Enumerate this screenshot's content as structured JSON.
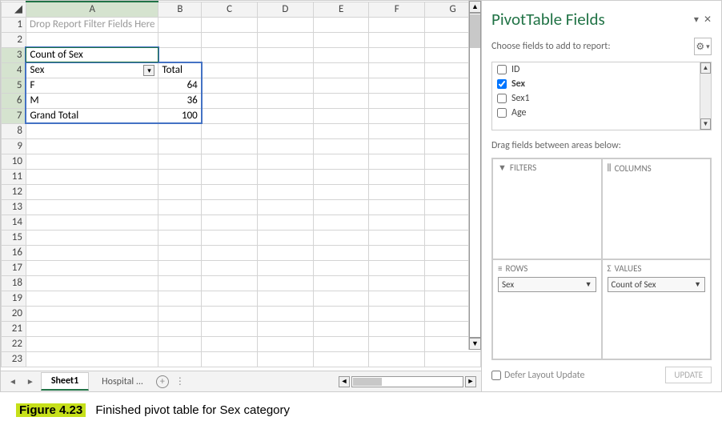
{
  "spreadsheet": {
    "columns": [
      "A",
      "B",
      "C",
      "D",
      "E",
      "F",
      "G"
    ],
    "row_count": 23,
    "drop_hint": "Drop Report Filter Fields Here",
    "pivot": {
      "title": "Count of Sex",
      "row_header": "Sex",
      "col_header": "Total",
      "rows": [
        {
          "label": "F",
          "value": 64
        },
        {
          "label": "M",
          "value": 36
        },
        {
          "label": "Grand Total",
          "value": 100
        }
      ]
    },
    "tabs": {
      "active": "Sheet1",
      "other": "Hospital",
      "ellipsis": "..."
    }
  },
  "panel": {
    "title": "PivotTable Fields",
    "subtitle": "Choose fields to add to report:",
    "fields": [
      {
        "name": "ID",
        "checked": false
      },
      {
        "name": "Sex",
        "checked": true
      },
      {
        "name": "Sex1",
        "checked": false
      },
      {
        "name": "Age",
        "checked": false
      }
    ],
    "drag_text": "Drag fields between areas below:",
    "areas": {
      "filters": "FILTERS",
      "columns": "COLUMNS",
      "rows": "ROWS",
      "values": "VALUES"
    },
    "rows_pill": "Sex",
    "values_pill": "Count of Sex",
    "defer": "Defer Layout Update",
    "update": "UPDATE"
  },
  "caption": {
    "figure": "Figure 4.23",
    "text": "Finished pivot table for Sex category"
  }
}
